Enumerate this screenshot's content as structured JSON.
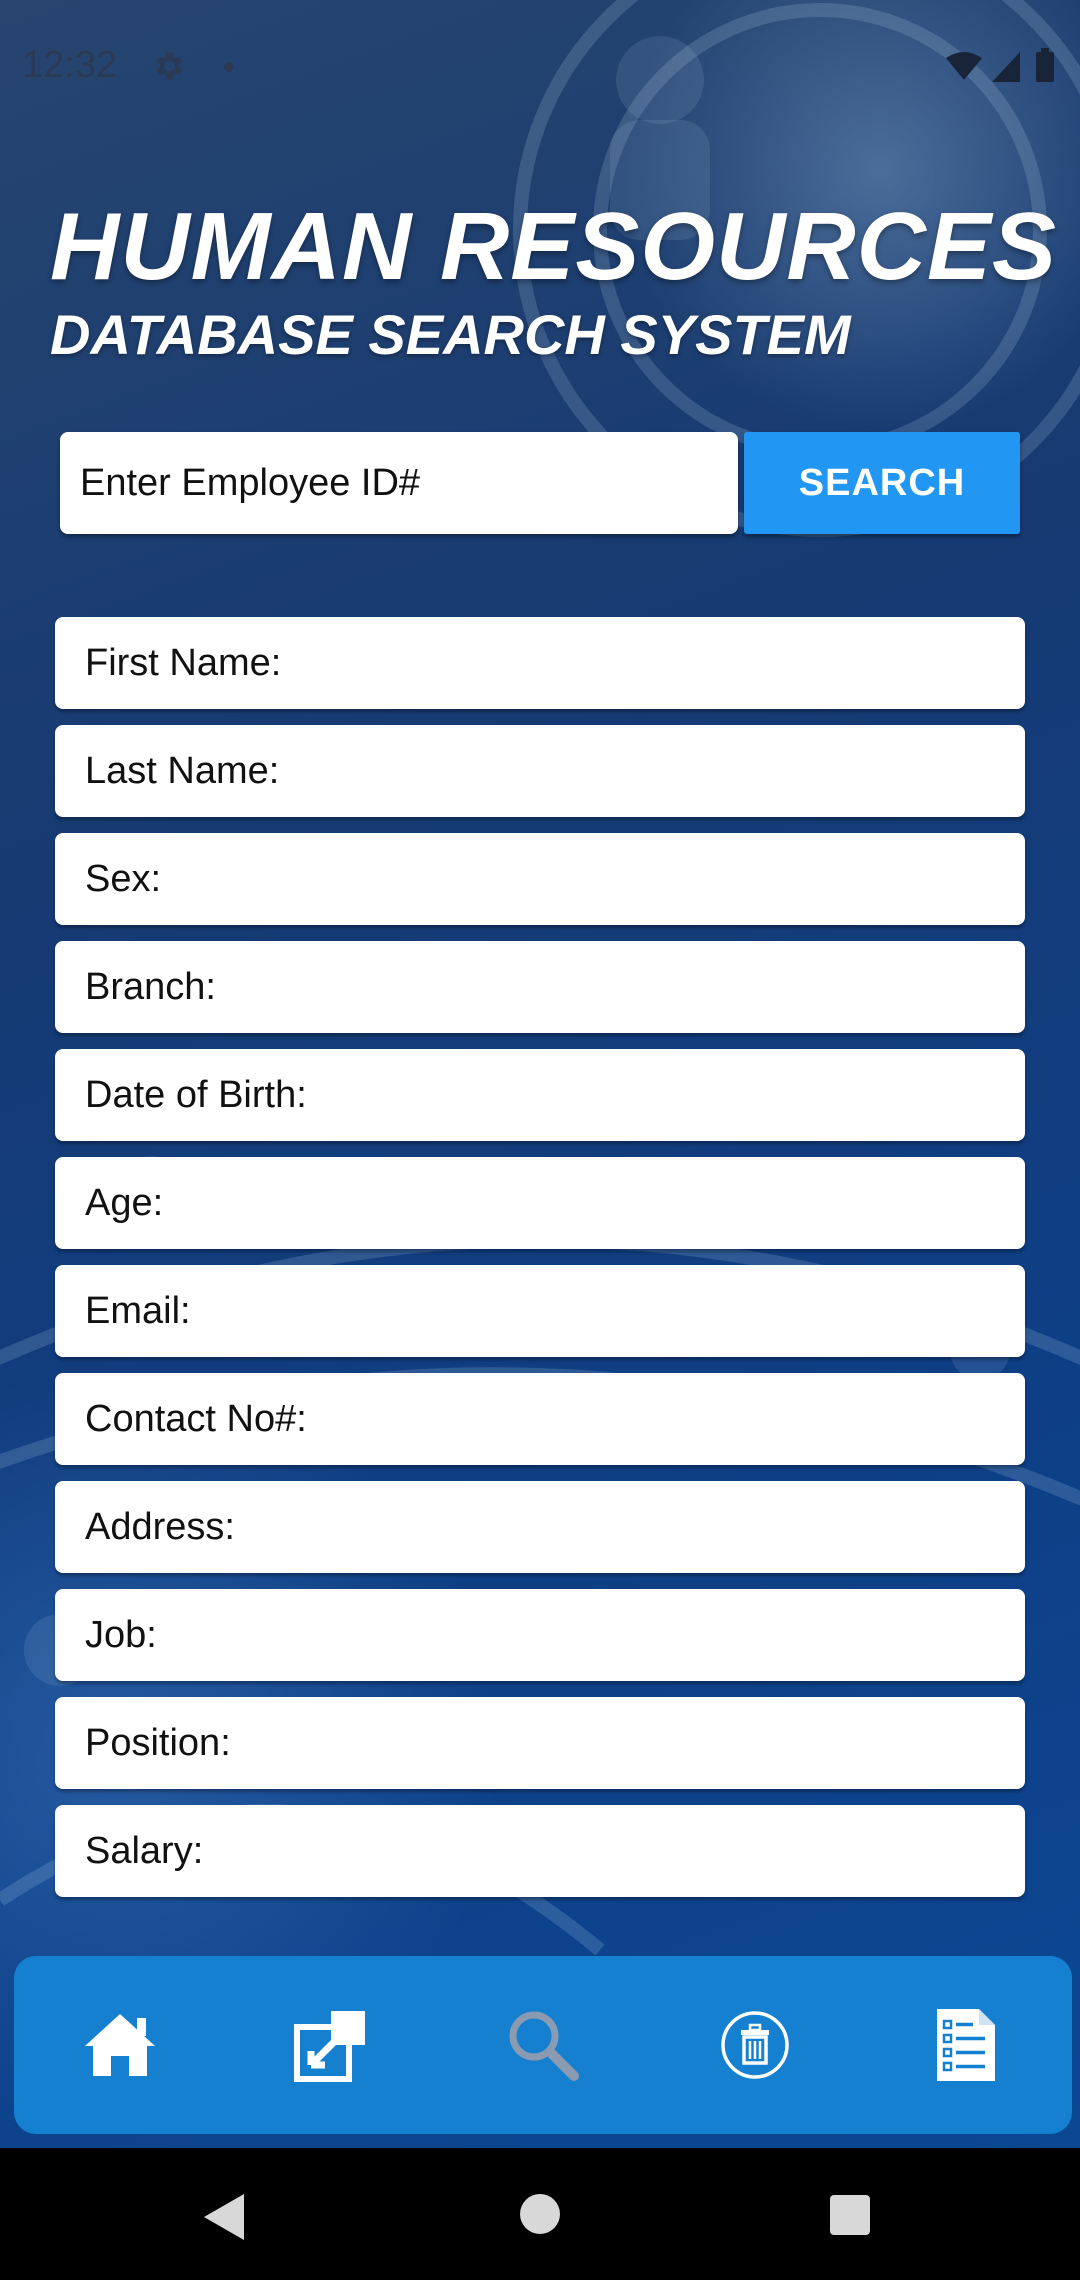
{
  "status_bar": {
    "time": "12:32"
  },
  "header": {
    "title": "HUMAN RESOURCES",
    "subtitle": "DATABASE SEARCH SYSTEM"
  },
  "search": {
    "placeholder": "Enter Employee ID#",
    "button_label": "SEARCH"
  },
  "fields": [
    "First Name:",
    "Last Name:",
    "Sex:",
    "Branch:",
    "Date of Birth:",
    "Age:",
    "Email:",
    "Contact No#:",
    "Address:",
    "Job:",
    "Position:",
    "Salary:"
  ],
  "bottom_nav": {
    "items": [
      "home-icon",
      "edit-icon",
      "search-icon",
      "delete-icon",
      "list-icon"
    ],
    "active": "search-icon",
    "active_color": "#8a9ab0"
  },
  "colors": {
    "accent": "#2196f3",
    "nav_background": "#1580d0"
  }
}
